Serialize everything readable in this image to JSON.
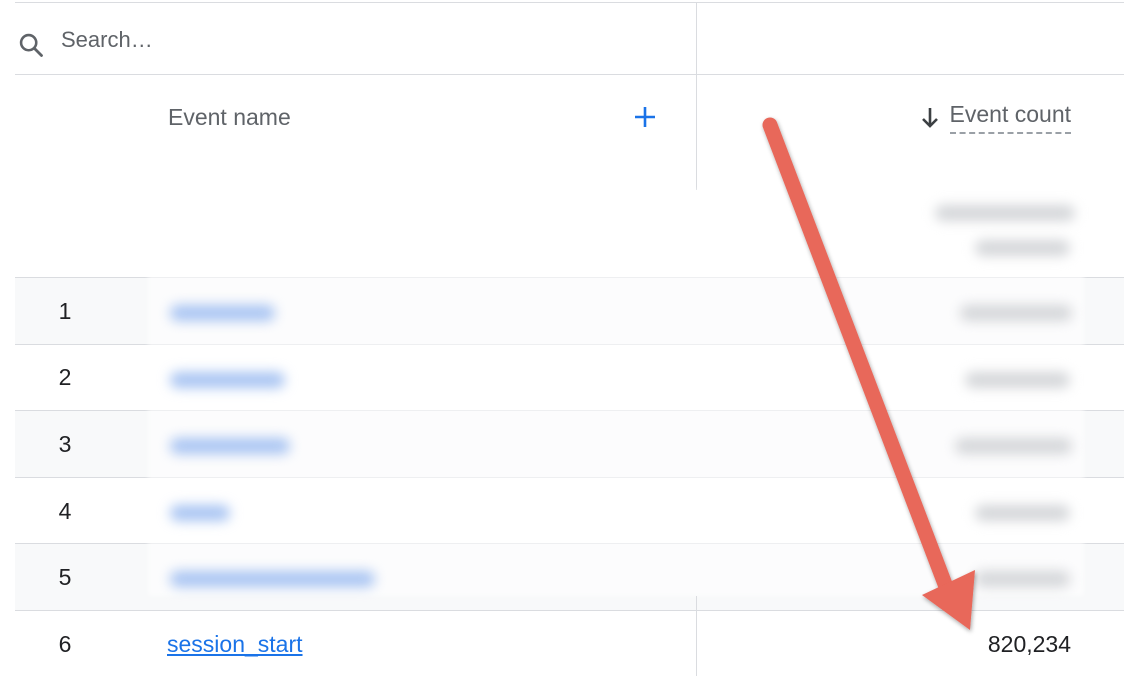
{
  "search": {
    "placeholder": "Search…"
  },
  "table": {
    "columns": {
      "event_name": "Event name",
      "event_count": "Event count"
    },
    "rows": [
      {
        "index": "1",
        "event_name": "",
        "event_count": ""
      },
      {
        "index": "2",
        "event_name": "",
        "event_count": ""
      },
      {
        "index": "3",
        "event_name": "",
        "event_count": ""
      },
      {
        "index": "4",
        "event_name": "",
        "event_count": ""
      },
      {
        "index": "5",
        "event_name": "",
        "event_count": ""
      },
      {
        "index": "6",
        "event_name": "session_start",
        "event_count": "820,234"
      }
    ]
  },
  "icons": {
    "search": "search-icon",
    "add_dimension": "plus-icon",
    "sort": "arrow-down-icon",
    "annotation": "red-arrow-annotation"
  },
  "colors": {
    "link": "#1a73e8",
    "annotation_arrow": "#e8675a",
    "row_shade": "#f8f9fa",
    "divider": "#dadce0"
  }
}
